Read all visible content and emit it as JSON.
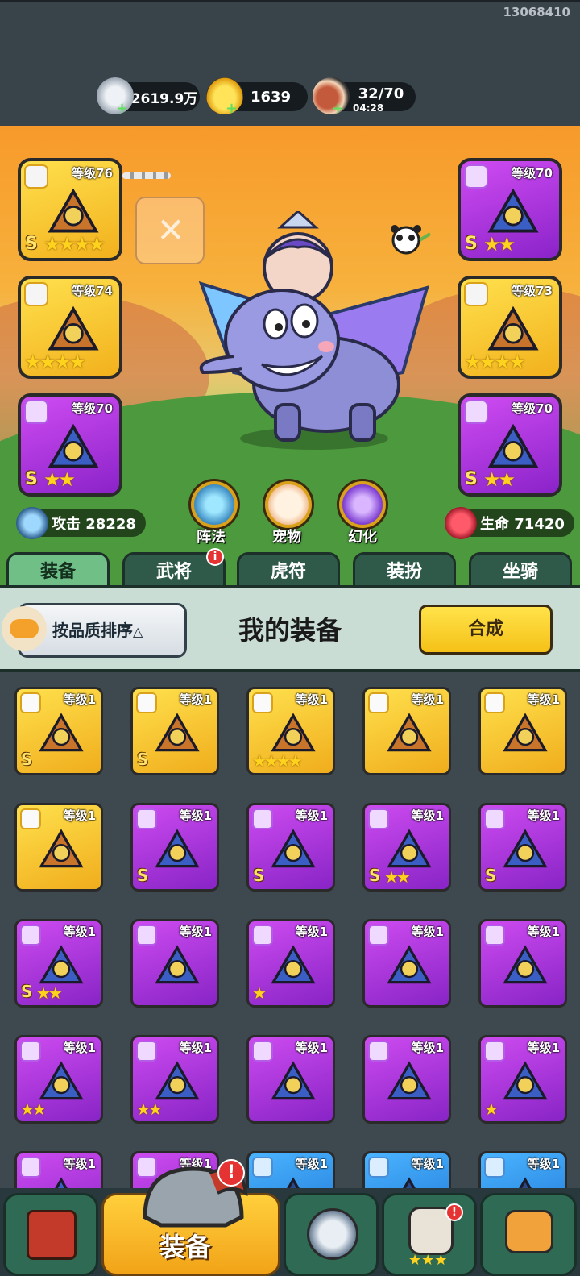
{
  "watermark": "13068410",
  "resources": {
    "silver": "2619.9万",
    "gold": "1639",
    "stamina": "32/70",
    "stamina_timer": "04:28"
  },
  "equipped_left": [
    {
      "level": "等级76",
      "rarity": "gold",
      "grade": "S",
      "stars": 4,
      "badge": "yin-yang-icon"
    },
    {
      "level": "等级74",
      "rarity": "gold",
      "grade": "",
      "stars": 4,
      "badge": "medal-icon"
    },
    {
      "level": "等级70",
      "rarity": "purple",
      "grade": "S",
      "stars": 2,
      "badge": "helmet-icon"
    }
  ],
  "equipped_right": [
    {
      "level": "等级70",
      "rarity": "purple",
      "grade": "S",
      "stars": 2,
      "badge": "armor-icon"
    },
    {
      "level": "等级73",
      "rarity": "gold",
      "grade": "",
      "stars": 4,
      "badge": "bracer-icon"
    },
    {
      "level": "等级70",
      "rarity": "purple",
      "grade": "S",
      "stars": 2,
      "badge": "boot-icon"
    }
  ],
  "features": {
    "formation": "阵法",
    "pet": "宠物",
    "transform": "幻化"
  },
  "stats": {
    "attack": "攻击 28228",
    "hp": "生命 71420"
  },
  "tabs": [
    "装备",
    "武将",
    "虎符",
    "装扮",
    "坐骑"
  ],
  "sort_button": "按品质排序",
  "section_title": "我的装备",
  "merge_button": "合成",
  "inventory": [
    {
      "level": "等级1",
      "rarity": "gold",
      "grade": "S",
      "stars": 0
    },
    {
      "level": "等级1",
      "rarity": "gold",
      "grade": "S",
      "stars": 0
    },
    {
      "level": "等级1",
      "rarity": "gold",
      "grade": "",
      "stars": 4
    },
    {
      "level": "等级1",
      "rarity": "gold",
      "grade": "",
      "stars": 0
    },
    {
      "level": "等级1",
      "rarity": "gold",
      "grade": "",
      "stars": 0
    },
    {
      "level": "等级1",
      "rarity": "gold",
      "grade": "",
      "stars": 0
    },
    {
      "level": "等级1",
      "rarity": "purple",
      "grade": "S",
      "stars": 0
    },
    {
      "level": "等级1",
      "rarity": "purple",
      "grade": "S",
      "stars": 0
    },
    {
      "level": "等级1",
      "rarity": "purple",
      "grade": "S",
      "stars": 2
    },
    {
      "level": "等级1",
      "rarity": "purple",
      "grade": "S",
      "stars": 0
    },
    {
      "level": "等级1",
      "rarity": "purple",
      "grade": "S",
      "stars": 2
    },
    {
      "level": "等级1",
      "rarity": "purple",
      "grade": "",
      "stars": 0
    },
    {
      "level": "等级1",
      "rarity": "purple",
      "grade": "",
      "stars": 1
    },
    {
      "level": "等级1",
      "rarity": "purple",
      "grade": "",
      "stars": 0
    },
    {
      "level": "等级1",
      "rarity": "purple",
      "grade": "",
      "stars": 0
    },
    {
      "level": "等级1",
      "rarity": "purple",
      "grade": "",
      "stars": 2
    },
    {
      "level": "等级1",
      "rarity": "purple",
      "grade": "",
      "stars": 2
    },
    {
      "level": "等级1",
      "rarity": "purple",
      "grade": "",
      "stars": 0
    },
    {
      "level": "等级1",
      "rarity": "purple",
      "grade": "",
      "stars": 0
    },
    {
      "level": "等级1",
      "rarity": "purple",
      "grade": "",
      "stars": 1
    },
    {
      "level": "等级1",
      "rarity": "purple",
      "grade": "",
      "stars": 0
    },
    {
      "level": "等级1",
      "rarity": "purple",
      "grade": "",
      "stars": 0
    },
    {
      "level": "等级1",
      "rarity": "blue",
      "grade": "",
      "stars": 0
    },
    {
      "level": "等级1",
      "rarity": "blue",
      "grade": "",
      "stars": 0
    },
    {
      "level": "等级1",
      "rarity": "blue",
      "grade": "",
      "stars": 0
    }
  ],
  "bottom_nav": {
    "active_label": "装备"
  },
  "colors": {
    "gold": "#f2b11d",
    "purple": "#8a23c9",
    "blue": "#1e74d4",
    "tab_active": "#6fbf87",
    "merge": "#f5c117"
  }
}
